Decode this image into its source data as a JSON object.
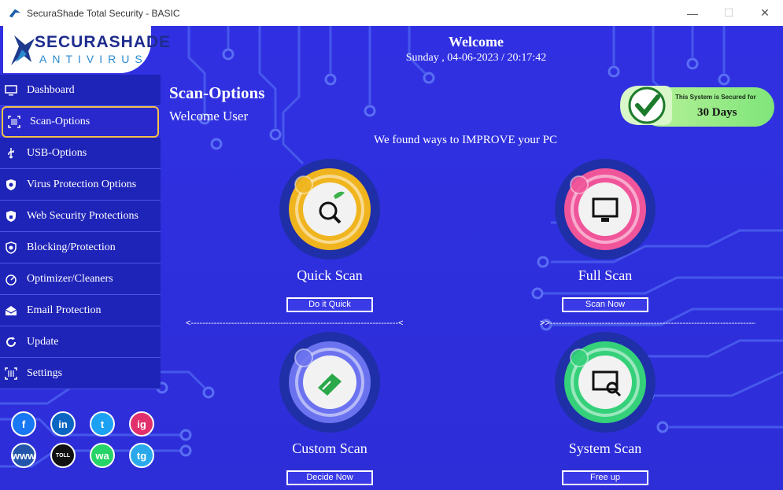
{
  "window": {
    "title": "SecuraShade Total Security - BASIC",
    "minimize_icon": "minimize-icon",
    "maximize_icon": "maximize-icon",
    "close_icon": "close-icon"
  },
  "brand": {
    "name": "SECURASHADE",
    "sub": "ANTIVIRUS"
  },
  "header": {
    "welcome": "Welcome",
    "datetime": "Sunday , 04-06-2023 / 20:17:42"
  },
  "sidebar": {
    "items": [
      {
        "label": "Dashboard",
        "icon": "monitor-icon"
      },
      {
        "label": "Scan-Options",
        "icon": "barcode-scan-icon",
        "active": true
      },
      {
        "label": "USB-Options",
        "icon": "usb-icon"
      },
      {
        "label": "Virus Protection Options",
        "icon": "shield-virus-icon"
      },
      {
        "label": "Web Security Protections",
        "icon": "shield-lock-icon"
      },
      {
        "label": "Blocking/Protection",
        "icon": "shield-block-icon"
      },
      {
        "label": "Optimizer/Cleaners",
        "icon": "optimizer-icon"
      },
      {
        "label": "Email Protection",
        "icon": "email-icon"
      },
      {
        "label": "Update",
        "icon": "refresh-icon"
      },
      {
        "label": "Settings",
        "icon": "settings-icon"
      }
    ]
  },
  "page": {
    "title": "Scan-Options",
    "subtitle": "Welcome User",
    "improve": "We found ways to IMPROVE your PC"
  },
  "secured": {
    "line1": "This System is Secured for",
    "line2": "30 Days"
  },
  "scans": [
    {
      "name": "Quick Scan",
      "button": "Do it Quick",
      "color": "#f0b51e"
    },
    {
      "name": "Full Scan",
      "button": "Scan Now",
      "color": "#f0559a"
    },
    {
      "name": "Custom Scan",
      "button": "Decide Now",
      "color": "#6b72f0"
    },
    {
      "name": "System Scan",
      "button": "Free up",
      "color": "#35d07a"
    }
  ],
  "dividers": {
    "left": "<------------------------------------------------------------------------<<",
    "right": ">>-----------------------------------------------------------------------------------------> "
  },
  "socials": [
    {
      "label": "f",
      "icon": "facebook-icon",
      "color": "#1877f2"
    },
    {
      "label": "in",
      "icon": "linkedin-icon",
      "color": "#0a66c2"
    },
    {
      "label": "t",
      "icon": "twitter-icon",
      "color": "#1da1f2"
    },
    {
      "label": "ig",
      "icon": "instagram-icon",
      "color": "#e1306c"
    },
    {
      "label": "www",
      "icon": "globe-icon",
      "color": "#2255aa"
    },
    {
      "label": "TOLL",
      "icon": "toll-free-icon",
      "color": "#111111"
    },
    {
      "label": "wa",
      "icon": "whatsapp-icon",
      "color": "#25d366"
    },
    {
      "label": "tg",
      "icon": "telegram-icon",
      "color": "#29a9eb"
    }
  ]
}
